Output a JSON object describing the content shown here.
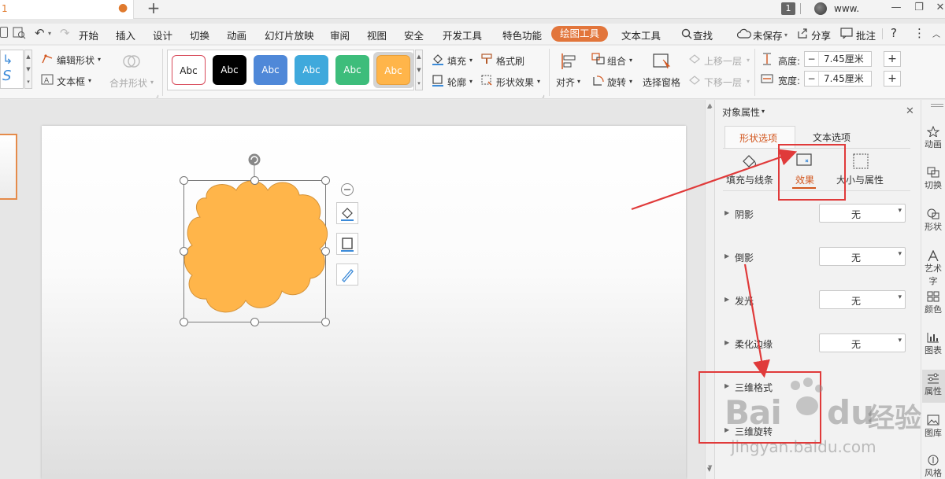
{
  "titlebar": {
    "tab_number": "1",
    "new_tab": "+",
    "page_badge": "1",
    "username": "www."
  },
  "menu": {
    "items": [
      "开始",
      "插入",
      "设计",
      "切换",
      "动画",
      "幻灯片放映",
      "审阅",
      "视图",
      "安全",
      "开发工具",
      "特色功能",
      "绘图工具",
      "文本工具",
      "查找"
    ],
    "right_items": [
      "未保存",
      "分享",
      "批注",
      "?"
    ]
  },
  "ribbon": {
    "edit_shape": "编辑形状",
    "text_box": "文本框",
    "merge_shape": "合并形状",
    "style_label": "Abc",
    "fill": "填充",
    "format_painter": "格式刷",
    "outline": "轮廓",
    "shape_effect": "形状效果",
    "align": "对齐",
    "group": "组合",
    "rotate": "旋转",
    "selection_pane": "选择窗格",
    "bring_forward": "上移一层",
    "send_backward": "下移一层",
    "height_label": "高度:",
    "width_label": "宽度:",
    "height_value": "7.45厘米",
    "width_value": "7.45厘米",
    "minus": "−",
    "plus": "+"
  },
  "colors": {
    "accent": "#e2753b",
    "shape_fill": "#ffb54a",
    "shape_stroke": "#d4933a",
    "annotation_red": "#e03a3a"
  },
  "panel": {
    "title": "对象属性",
    "tabs": [
      "形状选项",
      "文本选项"
    ],
    "subtabs": [
      "填充与线条",
      "效果",
      "大小与属性"
    ],
    "rows": [
      {
        "label": "阴影",
        "value": "无"
      },
      {
        "label": "倒影",
        "value": "无"
      },
      {
        "label": "发光",
        "value": "无"
      },
      {
        "label": "柔化边缘",
        "value": "无"
      }
    ],
    "extra_rows": [
      "三维格式",
      "三维旋转"
    ]
  },
  "right_sidebar": [
    "动画",
    "切换",
    "形状",
    "艺术字",
    "颜色",
    "图表",
    "属性",
    "图库",
    "风格"
  ],
  "watermark": {
    "brand": "Bai",
    "brand2": "du",
    "cn": "经验",
    "url": "jingyan.baidu.com"
  }
}
